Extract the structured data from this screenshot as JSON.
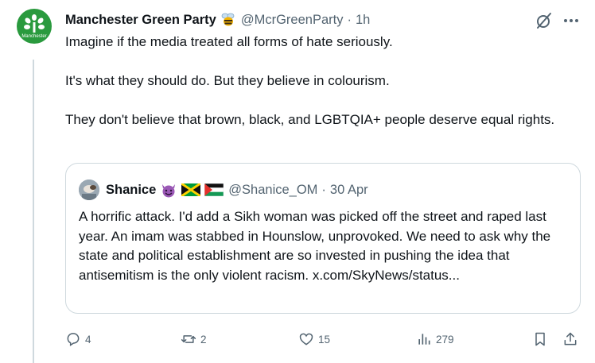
{
  "tweet": {
    "author_name": "Manchester Green Party",
    "author_handle": "@McrGreenParty",
    "separator": "·",
    "timestamp": "1h",
    "avatar_text": "Manchester",
    "paragraphs": [
      "Imagine if the media treated all forms of hate seriously.",
      "It's what they should do. But they believe in colourism.",
      "They don't believe that brown, black, and LGBTQIA+ people deserve equal rights."
    ]
  },
  "quote": {
    "author_name": "Shanice",
    "author_handle": "@Shanice_OM",
    "separator": "·",
    "timestamp": "30 Apr",
    "text": "A horrific attack. I'd add a Sikh woman was picked off the street and raped last year. An imam was stabbed in Hounslow, unprovoked. We need to ask why the state and political establishment are so invested in pushing the idea that antisemitism is the only violent racism. x.com/SkyNews/status..."
  },
  "actions": {
    "replies": "4",
    "reposts": "2",
    "likes": "15",
    "views": "279"
  },
  "icons": [
    "bee-emoji",
    "grok-icon",
    "more-icon",
    "devil-emoji",
    "jamaica-flag",
    "palestine-flag",
    "reply-icon",
    "repost-icon",
    "like-icon",
    "views-icon",
    "bookmark-icon",
    "share-icon"
  ],
  "colors": {
    "text": "#0f1419",
    "secondary": "#536471",
    "border": "#cfd9de",
    "brand_green": "#2a9a3e"
  }
}
